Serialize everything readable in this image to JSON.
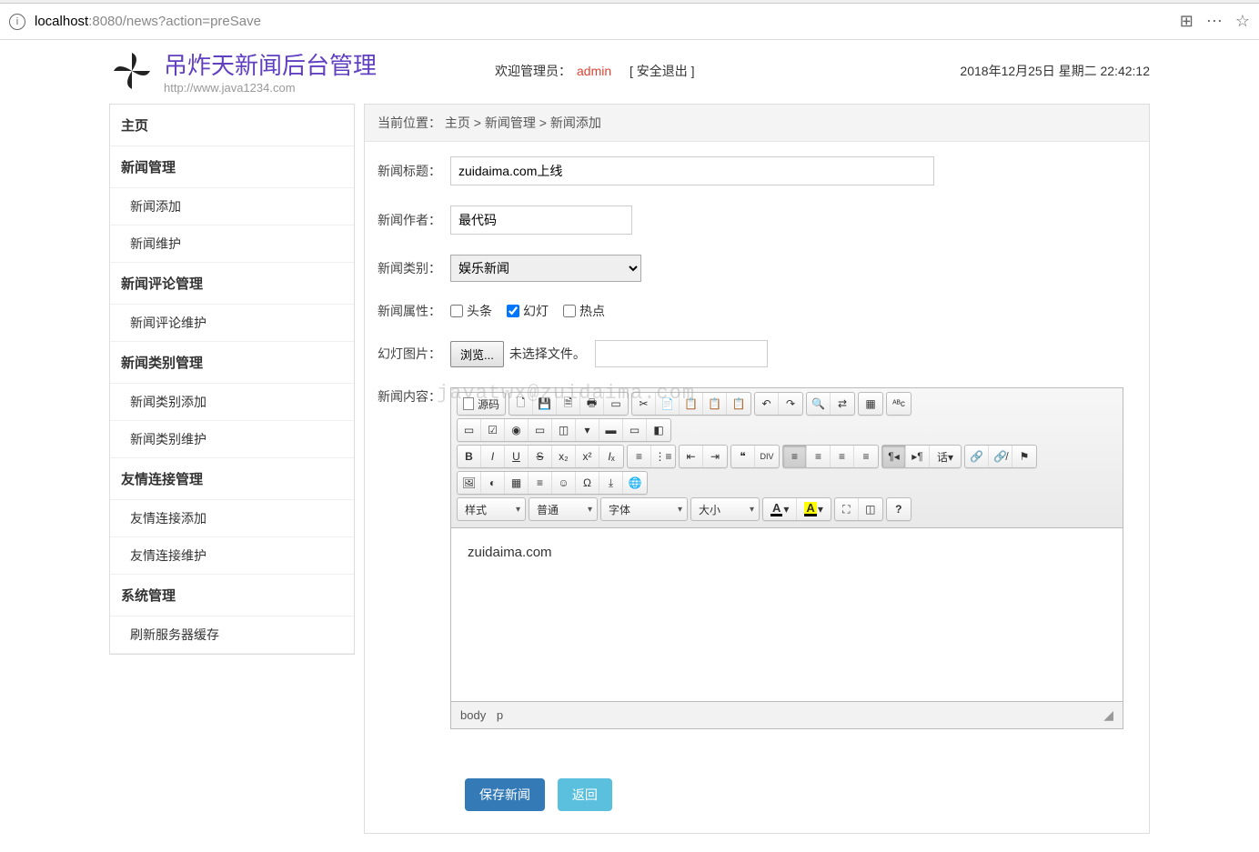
{
  "url": {
    "host": "localhost",
    "port": ":8080",
    "path": "/news?action=preSave"
  },
  "header": {
    "logo_title": "吊炸天新闻后台管理",
    "logo_sub": "http://www.java1234.com",
    "welcome_prefix": "欢迎管理员：",
    "admin": "admin",
    "safe_exit": "[ 安全退出 ]",
    "datetime": "2018年12月25日 星期二 22:42:12"
  },
  "sidebar": [
    {
      "type": "head",
      "label": "主页"
    },
    {
      "type": "head",
      "label": "新闻管理"
    },
    {
      "type": "item",
      "label": "新闻添加"
    },
    {
      "type": "item",
      "label": "新闻维护"
    },
    {
      "type": "head",
      "label": "新闻评论管理"
    },
    {
      "type": "item",
      "label": "新闻评论维护"
    },
    {
      "type": "head",
      "label": "新闻类别管理"
    },
    {
      "type": "item",
      "label": "新闻类别添加"
    },
    {
      "type": "item",
      "label": "新闻类别维护"
    },
    {
      "type": "head",
      "label": "友情连接管理"
    },
    {
      "type": "item",
      "label": "友情连接添加"
    },
    {
      "type": "item",
      "label": "友情连接维护"
    },
    {
      "type": "head",
      "label": "系统管理"
    },
    {
      "type": "item",
      "label": "刷新服务器缓存"
    }
  ],
  "breadcrumb": {
    "prefix": "当前位置：",
    "parts": [
      "主页",
      "新闻管理",
      "新闻添加"
    ],
    "sep": ">"
  },
  "form": {
    "title_label": "新闻标题：",
    "title_value": "zuidaima.com上线",
    "author_label": "新闻作者：",
    "author_value": "最代码",
    "category_label": "新闻类别：",
    "category_value": "娱乐新闻",
    "attr_label": "新闻属性：",
    "attr_options": [
      {
        "label": "头条",
        "checked": false
      },
      {
        "label": "幻灯",
        "checked": true
      },
      {
        "label": "热点",
        "checked": false
      }
    ],
    "slide_label": "幻灯图片：",
    "browse_btn": "浏览...",
    "no_file": "未选择文件。",
    "content_label": "新闻内容："
  },
  "editor": {
    "source_label": "源码",
    "dropdowns": {
      "style": "样式",
      "format": "普通",
      "font": "字体",
      "size": "大小"
    },
    "body_text": "zuidaima.com",
    "path": [
      "body",
      "p"
    ]
  },
  "buttons": {
    "save": "保存新闻",
    "back": "返回"
  },
  "watermark": "javatwx@zuidaima.com"
}
